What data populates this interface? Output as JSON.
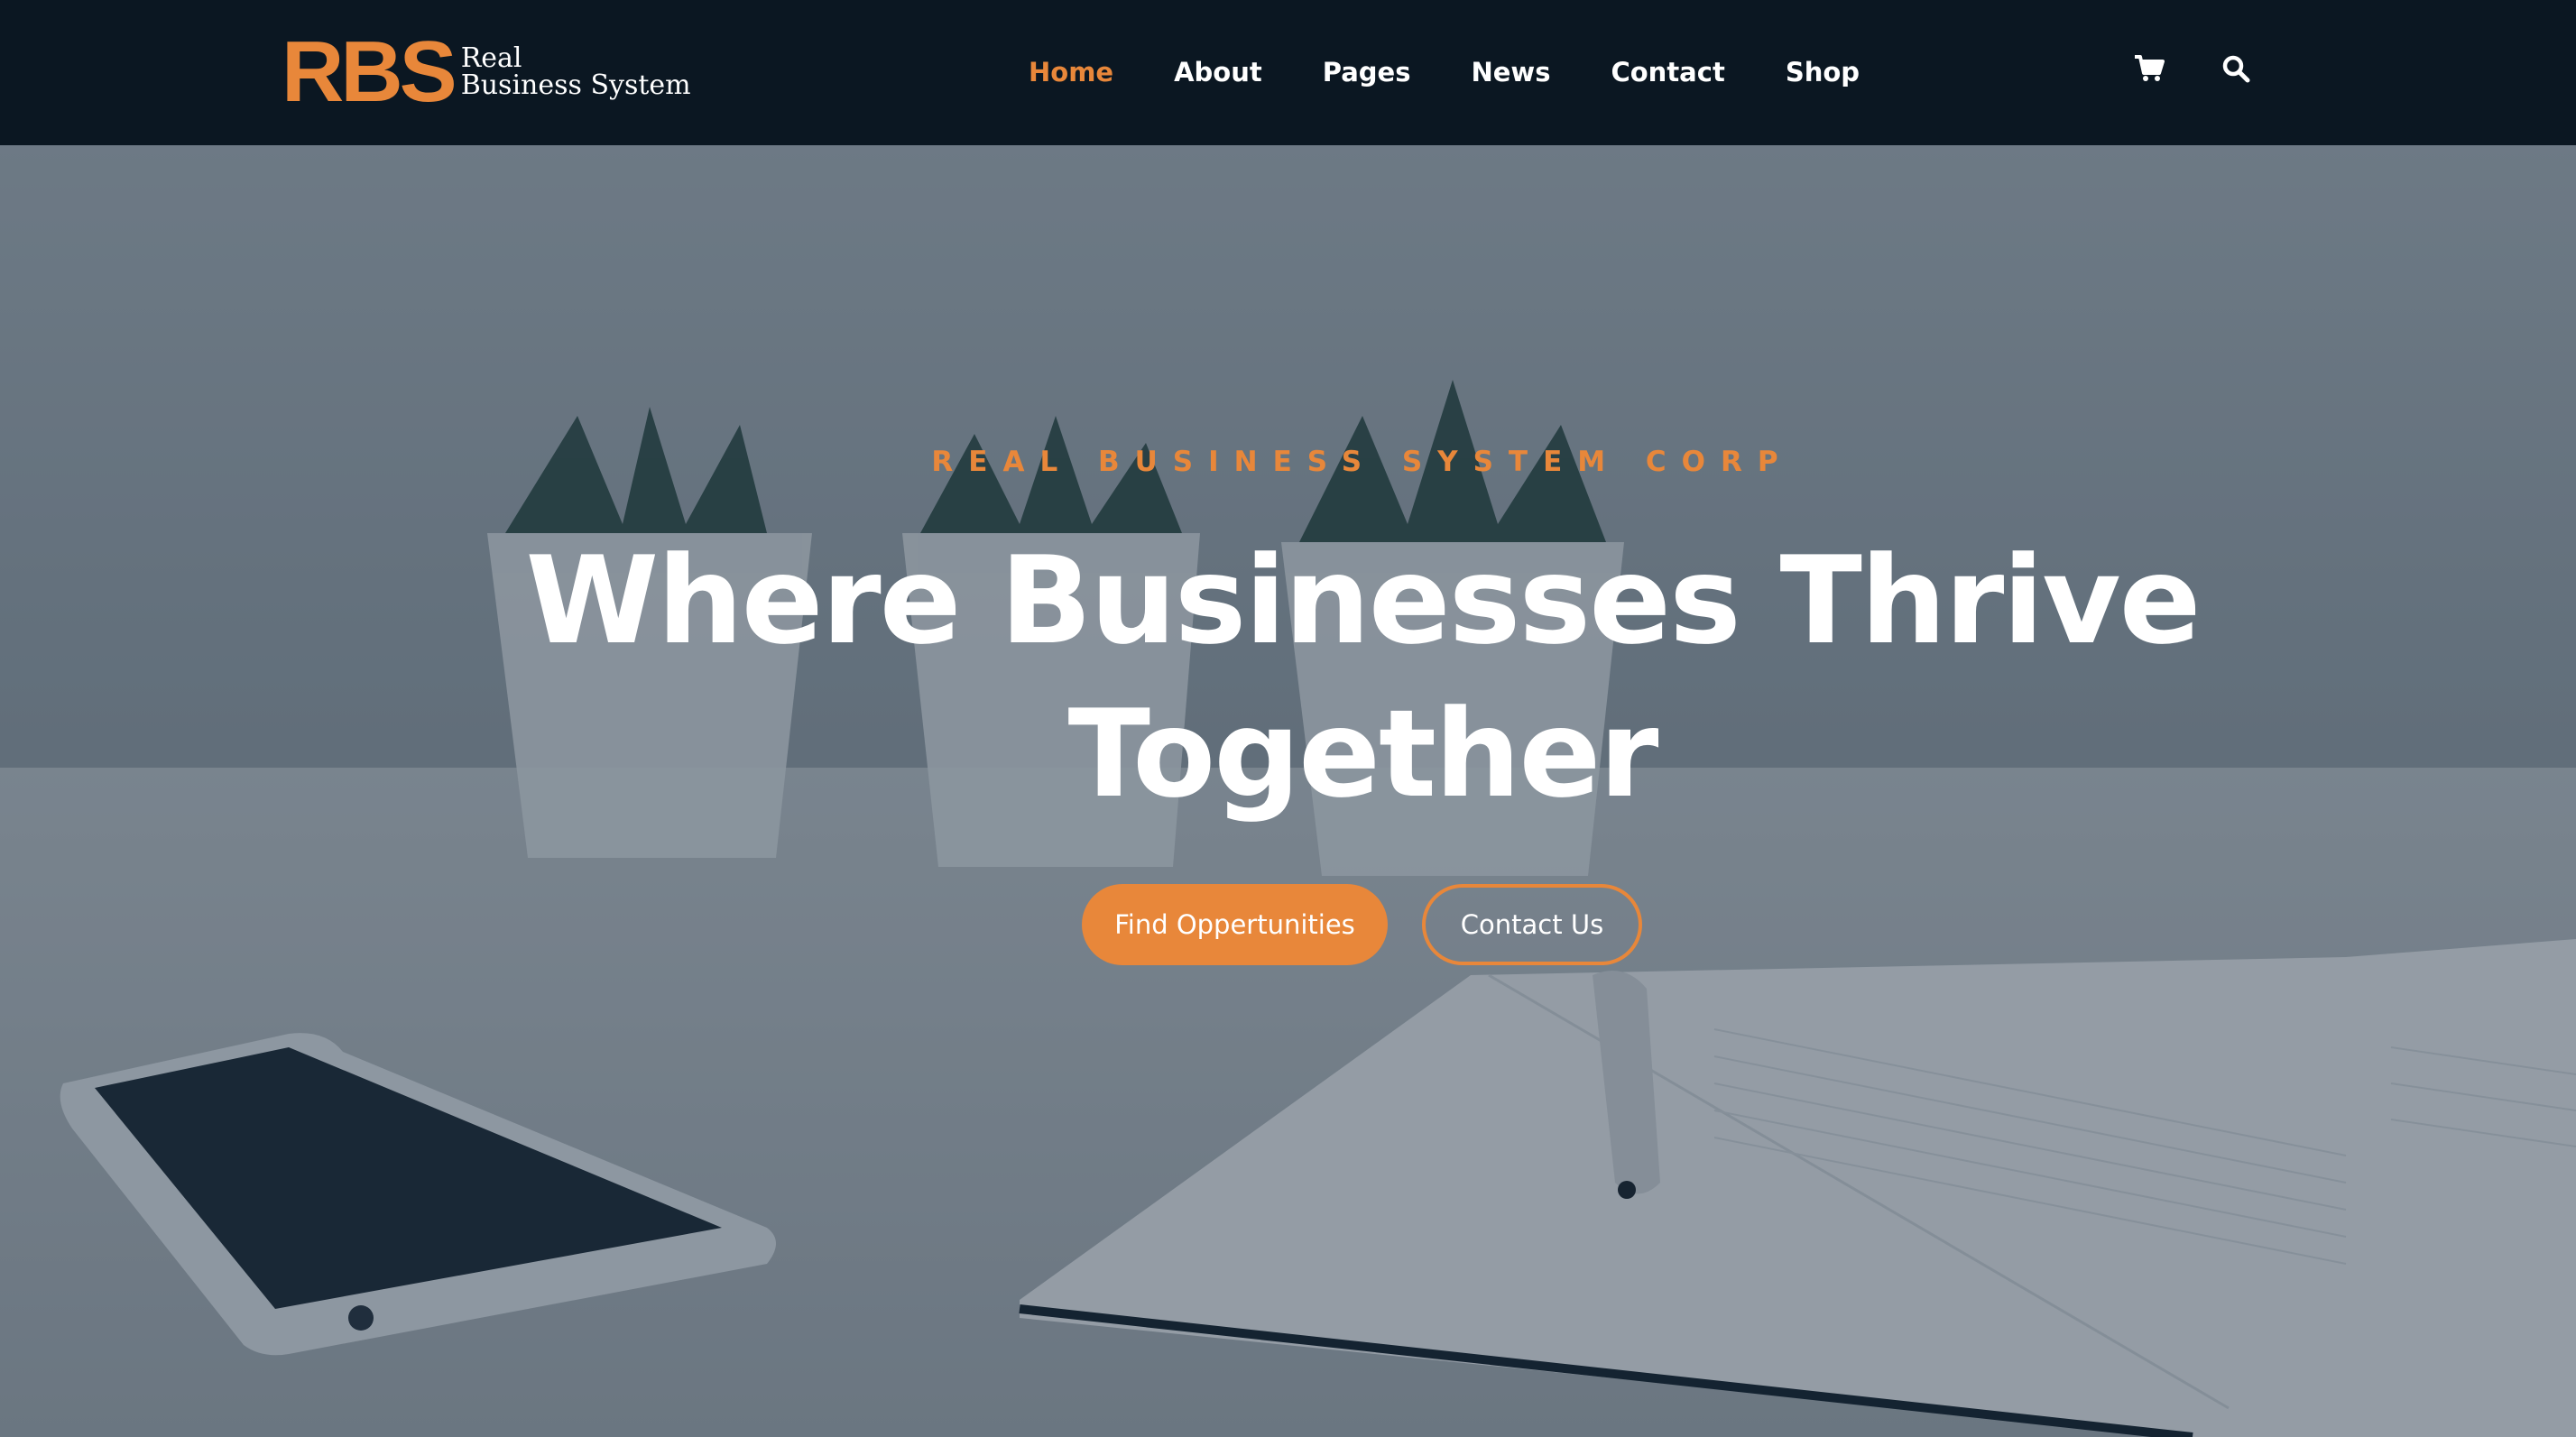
{
  "brand": {
    "mark": "RBS",
    "line1": "Real",
    "line2": "Business System",
    "accent_color": "#e8873a"
  },
  "nav": {
    "items": [
      {
        "label": "Home",
        "active": true
      },
      {
        "label": "About",
        "active": false
      },
      {
        "label": "Pages",
        "active": false
      },
      {
        "label": "News",
        "active": false
      },
      {
        "label": "Contact",
        "active": false
      },
      {
        "label": "Shop",
        "active": false
      }
    ],
    "active_color": "#e8873a",
    "text_color": "#ffffff"
  },
  "header_icons": {
    "cart": "cart-icon",
    "search": "search-icon"
  },
  "hero": {
    "eyebrow": "REAL BUSINESS SYSTEM CORP",
    "headline_line1": "Where Businesses Thrive",
    "headline_line2": "Together",
    "primary_cta": "Find Oppertunities",
    "secondary_cta": "Contact Us"
  },
  "colors": {
    "header_bg": "#0b1722",
    "accent": "#e8873a",
    "white": "#ffffff"
  }
}
